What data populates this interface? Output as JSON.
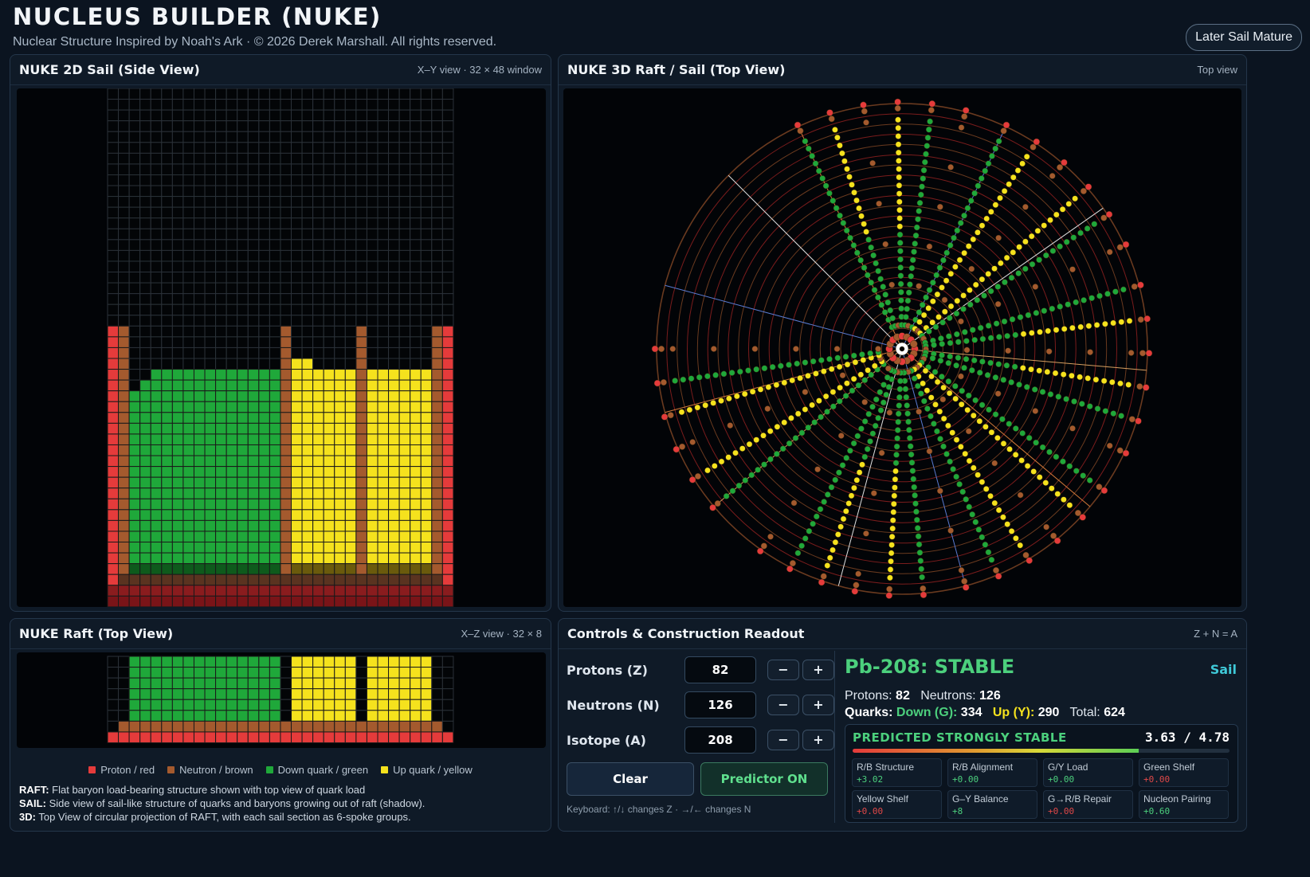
{
  "header": {
    "title": "NUCLEUS BUILDER (NUKE)",
    "subtitle": "Nuclear Structure Inspired by Noah's Ark · © 2026 Derek Marshall. All rights reserved.",
    "mode_button": "Later Sail Mature"
  },
  "panels": {
    "side": {
      "title": "NUKE 2D Sail (Side View)",
      "meta": "X–Y view · 32 × 48 window"
    },
    "top3d": {
      "title": "NUKE 3D Raft / Sail (Top View)",
      "meta": "Top view"
    },
    "raft": {
      "title": "NUKE Raft (Top View)",
      "meta": "X–Z view · 32 × 8"
    },
    "controls": {
      "title": "Controls & Construction Readout",
      "meta": "Z + N = A"
    }
  },
  "legend": [
    {
      "label": "Proton / red",
      "color": "#e53b3b"
    },
    {
      "label": "Neutron / brown",
      "color": "#a45a2e"
    },
    {
      "label": "Down quark / green",
      "color": "#1fa83a"
    },
    {
      "label": "Up quark / yellow",
      "color": "#f5e21d"
    }
  ],
  "notes": [
    {
      "key": "RAFT:",
      "text": "Flat baryon load-bearing structure shown with top view of quark load"
    },
    {
      "key": "SAIL:",
      "text": "Side view of sail-like structure of quarks and baryons growing out of raft (shadow)."
    },
    {
      "key": "3D:",
      "text": "Top View of circular projection of RAFT, with each sail section as 6-spoke groups."
    }
  ],
  "controls": {
    "protons": {
      "label": "Protons (Z)",
      "value": "82"
    },
    "neutrons": {
      "label": "Neutrons (N)",
      "value": "126"
    },
    "isotope": {
      "label": "Isotope (A)",
      "value": "208"
    },
    "minus": "−",
    "plus": "+",
    "clear_label": "Clear",
    "predictor_label": "Predictor ON",
    "keyboard_hint": "Keyboard: ↑/↓ changes Z · →/← changes N"
  },
  "readout": {
    "status": "Pb-208: STABLE",
    "tag": "Sail",
    "protons_label": "Protons:",
    "protons_value": "82",
    "neutrons_label": "Neutrons:",
    "neutrons_value": "126",
    "quarks_label": "Quarks:",
    "down_label": "Down (G):",
    "down_value": "334",
    "up_label": "Up (Y):",
    "up_value": "290",
    "total_label": "Total:",
    "total_value": "624",
    "prediction": "PREDICTED STRONGLY STABLE",
    "score": "3.63 / 4.78",
    "score_fraction": 0.76,
    "metrics": [
      {
        "name": "R/B Structure",
        "value": "+3.02",
        "color": "#4cd07d"
      },
      {
        "name": "R/B Alignment",
        "value": "+0.00",
        "color": "#4cd07d"
      },
      {
        "name": "G/Y Load",
        "value": "+0.00",
        "color": "#4cd07d"
      },
      {
        "name": "Green Shelf",
        "value": "+0.00",
        "color": "#e04848"
      },
      {
        "name": "Yellow Shelf",
        "value": "+0.00",
        "color": "#e04848"
      },
      {
        "name": "G–Y Balance",
        "value": "+8",
        "color": "#4cd07d"
      },
      {
        "name": "G→R/B Repair",
        "value": "+0.00",
        "color": "#e04848"
      },
      {
        "name": "Nucleon Pairing",
        "value": "+0.60",
        "color": "#4cd07d"
      }
    ]
  },
  "colors": {
    "proton": "#e53b3b",
    "neutron": "#a45a2e",
    "down": "#1fa83a",
    "up": "#f5e21d",
    "empty_grid": "#2a3138",
    "accent_green": "#4cd07d",
    "accent_cyan": "#3fc9d8"
  }
}
